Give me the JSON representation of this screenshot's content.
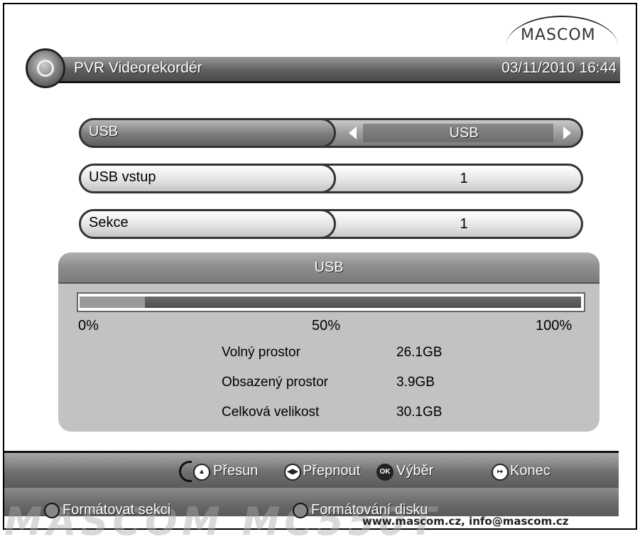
{
  "brand": {
    "logo_text": "MASCOM",
    "watermark": "MASCOM MC550T"
  },
  "header": {
    "title": "PVR Videorekordér",
    "datetime": "03/11/2010 16:44"
  },
  "options": [
    {
      "label": "USB",
      "value": "USB",
      "selected": true
    },
    {
      "label": "USB vstup",
      "value": "1",
      "selected": false
    },
    {
      "label": "Sekce",
      "value": "1",
      "selected": false
    }
  ],
  "usb_panel": {
    "title": "USB",
    "usage_fraction": 0.13,
    "ticks": [
      "0%",
      "50%",
      "100%"
    ],
    "info": [
      {
        "label": "Volný prostor",
        "value": "26.1GB"
      },
      {
        "label": "Obsazený prostor",
        "value": "3.9GB"
      },
      {
        "label": "Celková velikost",
        "value": "30.1GB"
      }
    ]
  },
  "help_bar": {
    "move": "Přesun",
    "switch": "Přepnout",
    "ok_icon": "OK",
    "select": "Výběr",
    "exit": "Konec"
  },
  "format_bar": {
    "format_section": "Formátovat sekci",
    "format_disk": "Formátování disku"
  },
  "contact": "www.mascom.cz, info@mascom.cz",
  "colors": {
    "header_gray": "#5f5f5f",
    "panel_gray": "#c2c2c2",
    "bar_fill": "#4e4e4e"
  }
}
